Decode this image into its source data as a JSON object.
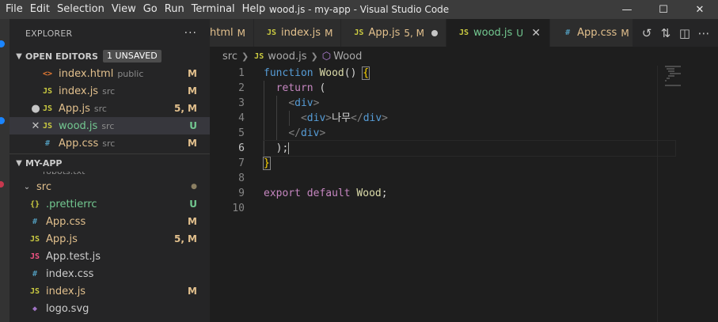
{
  "menu": [
    "File",
    "Edit",
    "Selection",
    "View",
    "Go",
    "Run",
    "Terminal",
    "Help"
  ],
  "window_title": "wood.js - my-app - Visual Studio Code",
  "window_controls": {
    "minimize": "—",
    "maximize": "☐",
    "close": "✕"
  },
  "explorer": {
    "title": "EXPLORER",
    "more": "···",
    "open_editors": {
      "label": "OPEN EDITORS",
      "badge": "1 UNSAVED",
      "items": [
        {
          "icon": "<>",
          "name": "index.html",
          "dir": "public",
          "status": "M"
        },
        {
          "icon": "JS",
          "name": "index.js",
          "dir": "src",
          "status": "M"
        },
        {
          "icon": "JS",
          "name": "App.js",
          "dir": "src",
          "status": "5, M"
        },
        {
          "icon": "JS",
          "name": "wood.js",
          "dir": "src",
          "status": "U"
        },
        {
          "icon": "#",
          "name": "App.css",
          "dir": "src",
          "status": "M"
        }
      ]
    },
    "project": {
      "label": "MY-APP",
      "cut_label": "robots.txt",
      "folder": "src",
      "files": [
        {
          "icon": "{}",
          "name": ".prettierrc",
          "status": "U"
        },
        {
          "icon": "#",
          "name": "App.css",
          "status": "M"
        },
        {
          "icon": "JS",
          "name": "App.js",
          "status": "5, M"
        },
        {
          "icon": "JS",
          "name": "App.test.js",
          "status": ""
        },
        {
          "icon": "#",
          "name": "index.css",
          "status": ""
        },
        {
          "icon": "JS",
          "name": "index.js",
          "status": "M"
        },
        {
          "icon": "◆",
          "name": "logo.svg",
          "status": ""
        }
      ]
    }
  },
  "tabs": [
    {
      "icon": "",
      "name": "html",
      "status": "M"
    },
    {
      "icon": "JS",
      "name": "index.js",
      "status": "M"
    },
    {
      "icon": "JS",
      "name": "App.js",
      "status": "5, M"
    },
    {
      "icon": "JS",
      "name": "wood.js",
      "status": "U"
    },
    {
      "icon": "#",
      "name": "App.css",
      "status": "M"
    }
  ],
  "breadcrumb": {
    "folder": "src",
    "file": "wood.js",
    "symbol": "Wood"
  },
  "editor": {
    "line_numbers": [
      "1",
      "2",
      "3",
      "4",
      "5",
      "6",
      "7",
      "8",
      "9",
      "10"
    ],
    "current_line": "6",
    "code": {
      "l1_kw": "function",
      "l1_name": "Wood",
      "l1_paren": "()",
      "l1_brace": "{",
      "l2_kw": "return",
      "l2_paren": "(",
      "l3_tag": "div",
      "l4_open": "div",
      "l4_text": "나무",
      "l4_close": "div",
      "l5_tag": "div",
      "l6_text": ");",
      "l7_brace": "}",
      "l9_export": "export",
      "l9_default": "default",
      "l9_name": "Wood",
      "l9_semi": ";"
    }
  },
  "colors": {
    "accent": "#007acc",
    "modified": "#e2c08d",
    "untracked": "#73c991"
  }
}
